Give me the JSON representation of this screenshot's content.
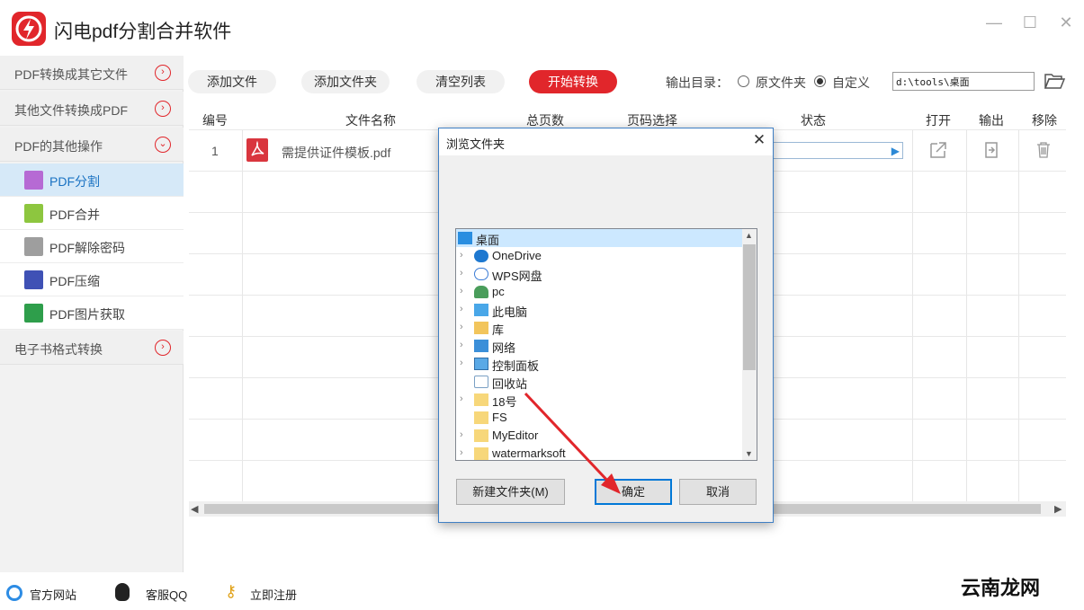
{
  "app": {
    "title": "闪电pdf分割合并软件"
  },
  "sidebar": {
    "headers": [
      {
        "label": "PDF转换成其它文件"
      },
      {
        "label": "其他文件转换成PDF"
      },
      {
        "label": "PDF的其他操作"
      },
      {
        "label": "电子书格式转换"
      }
    ],
    "items": [
      {
        "label": "PDF分割",
        "icon": "pdf-split-icon",
        "color": "#b66ad4"
      },
      {
        "label": "PDF合并",
        "icon": "pdf-merge-icon",
        "color": "#8dc63f"
      },
      {
        "label": "PDF解除密码",
        "icon": "lock-icon",
        "color": "#9e9e9e"
      },
      {
        "label": "PDF压缩",
        "icon": "compress-icon",
        "color": "#3f51b5"
      },
      {
        "label": "PDF图片获取",
        "icon": "image-icon",
        "color": "#2e9e4b"
      }
    ]
  },
  "toolbar": {
    "add_file": "添加文件",
    "add_folder": "添加文件夹",
    "clear_list": "清空列表",
    "start": "开始转换",
    "output_dir_label": "输出目录：",
    "radio_original": "原文件夹",
    "radio_custom": "自定义",
    "path": "d:\\tools\\桌面"
  },
  "table": {
    "headers": {
      "num": "编号",
      "name": "文件名称",
      "pages": "总页数",
      "range": "页码选择",
      "status": "状态",
      "open": "打开",
      "output": "输出",
      "remove": "移除"
    },
    "rows": [
      {
        "num": "1",
        "name": "需提供证件模板.pdf"
      }
    ]
  },
  "dialog": {
    "title": "浏览文件夹",
    "tree": [
      {
        "label": "桌面"
      },
      {
        "label": "OneDrive"
      },
      {
        "label": "WPS网盘"
      },
      {
        "label": "pc"
      },
      {
        "label": "此电脑"
      },
      {
        "label": "库"
      },
      {
        "label": "网络"
      },
      {
        "label": "控制面板"
      },
      {
        "label": "回收站"
      },
      {
        "label": "18号"
      },
      {
        "label": "FS"
      },
      {
        "label": "MyEditor"
      },
      {
        "label": "watermarksoft"
      }
    ],
    "new_folder": "新建文件夹(M)",
    "ok": "确定",
    "cancel": "取消"
  },
  "footer": {
    "website": "官方网站",
    "support": "客服QQ",
    "register": "立即注册"
  },
  "watermark": "云南龙网",
  "colors": {
    "accent": "#e1262b",
    "selected": "#d6e9f8"
  }
}
